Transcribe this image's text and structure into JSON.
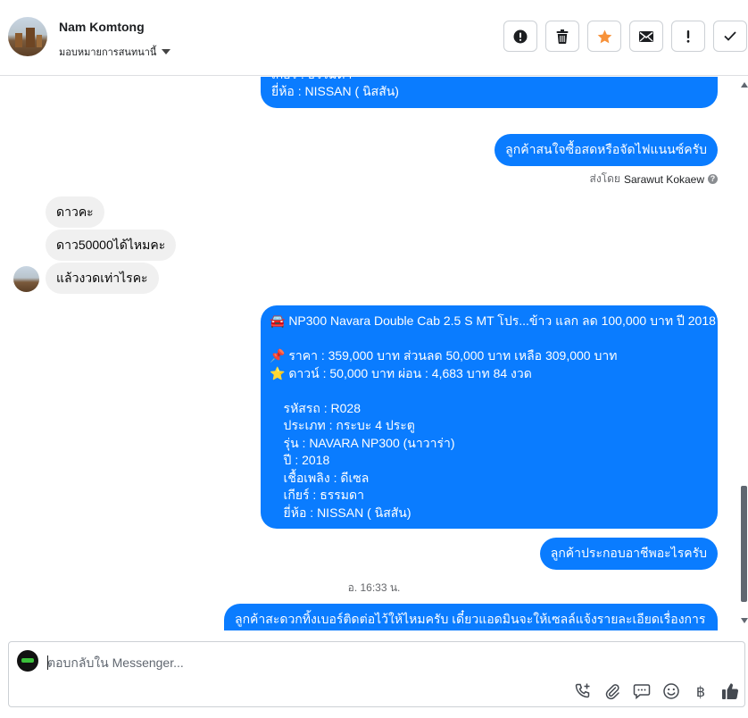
{
  "header": {
    "contact_name": "Nam Komtong",
    "assign_label": "มอบหมายการสนทนานี้",
    "actions": [
      {
        "name": "mark-spam-button",
        "icon": "alert-circle-icon"
      },
      {
        "name": "delete-button",
        "icon": "trash-icon"
      },
      {
        "name": "star-button",
        "icon": "star-icon"
      },
      {
        "name": "mark-unread-button",
        "icon": "envelope-icon"
      },
      {
        "name": "follow-up-button",
        "icon": "exclamation-icon"
      },
      {
        "name": "mark-done-button",
        "icon": "check-icon"
      }
    ],
    "star_color": "#f7923a"
  },
  "thread": {
    "msg1_partial": "เชื้อเพลิง : ดีเซล\nเกียร์ : ธรรมดา\nยี่ห้อ : NISSAN ( นิสสัน)",
    "msg2": "ลูกค้าสนใจซื้อสดหรือจัดไฟแนนซ์ครับ",
    "sent_by_prefix": "ส่งโดย",
    "sent_by_name": "Sarawut Kokaew",
    "incoming": [
      "ดาวคะ",
      "ดาว50000ได้ไหมคะ",
      "แล้วงวดเท่าไรคะ"
    ],
    "listing": "🚘 NP300 Navara Double Cab 2.5 S MT โปร...ข้าว แลก ลด 100,000 บาท ปี 2018\n\n📌 ราคา : 359,000 บาท ส่วนลด 50,000 บาท เหลือ 309,000 บาท\n⭐ ดาวน์ : 50,000 บาท ผ่อน : 4,683 บาท 84 งวด\n\n    รหัสรถ : R028\n    ประเภท : กระบะ 4 ประตู\n    รุ่น : NAVARA NP300 (นาวาร่า)\n    ปี : 2018\n    เชื้อเพลิง : ดีเซล\n    เกียร์ : ธรรมดา\n    ยี่ห้อ : NISSAN ( นิสสัน)",
    "msg_occupation": "ลูกค้าประกอบอาชีพอะไรครับ",
    "timestamp": "อ. 16:33 น.",
    "msg_last_partial": "ลูกค้าสะดวกทิ้งเบอร์ติดต่อไว้ให้ไหมครับ เดี๋ยวแอดมินจะให้เซลล์แจ้งรายละเอียดเรื่องการ"
  },
  "composer": {
    "placeholder": "ตอบกลับใน Messenger...",
    "tools": [
      "phone-plus-icon",
      "paperclip-icon",
      "saved-reply-icon",
      "emoji-icon",
      "baht-icon",
      "thumbs-up-icon"
    ],
    "baht_symbol": "฿"
  },
  "colors": {
    "outgoing_bubble": "#0a7cff",
    "incoming_bubble": "#f0f0f0"
  }
}
